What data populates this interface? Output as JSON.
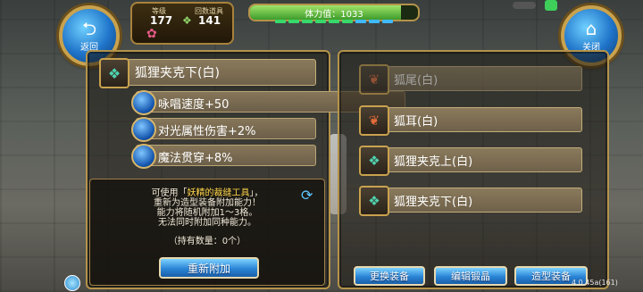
{
  "nav": {
    "back_label": "返回",
    "close_label": "关闭"
  },
  "stats": {
    "level_label": "等级",
    "level_value": "177",
    "ticket_label": "回数道具",
    "ticket_value": "141"
  },
  "stamina": {
    "label": "体力值：1033",
    "fill_fraction": 0.9
  },
  "selected_item": {
    "name": "狐狸夹克下(白)",
    "icon": "jacket-icon"
  },
  "attributes": [
    {
      "text": "咏唱速度+50"
    },
    {
      "text": "对光属性伤害+2%"
    },
    {
      "text": "魔法贯穿+8%"
    }
  ],
  "info": {
    "line1_prefix": "可使用「",
    "line1_highlight": "妖精的裁缝工具",
    "line1_suffix": "」，",
    "line2": "重新为造型装备附加能力！",
    "line3": "能力将随机附加1～3格。",
    "line4": "无法同时附加同种能力。",
    "quantity": "（持有数量：0个）",
    "reroll_button": "重新附加"
  },
  "equipment_list": [
    {
      "name": "狐尾(白)",
      "icon": "fox-tail-icon",
      "dim": true
    },
    {
      "name": "狐耳(白)",
      "icon": "fox-ear-icon",
      "dim": false
    },
    {
      "name": "狐狸夹克上(白)",
      "icon": "jacket-top-icon",
      "dim": false
    },
    {
      "name": "狐狸夹克下(白)",
      "icon": "jacket-bottom-icon",
      "dim": false
    }
  ],
  "bottom_buttons": {
    "change": "更换装备",
    "edit": "编辑锻晶",
    "style": "造型装备"
  },
  "version": "4.0.45a(161)",
  "colors": {
    "frame_gold": "#b4934a",
    "button_blue": "#2a84d6",
    "highlight_yellow": "#ffd64a"
  }
}
